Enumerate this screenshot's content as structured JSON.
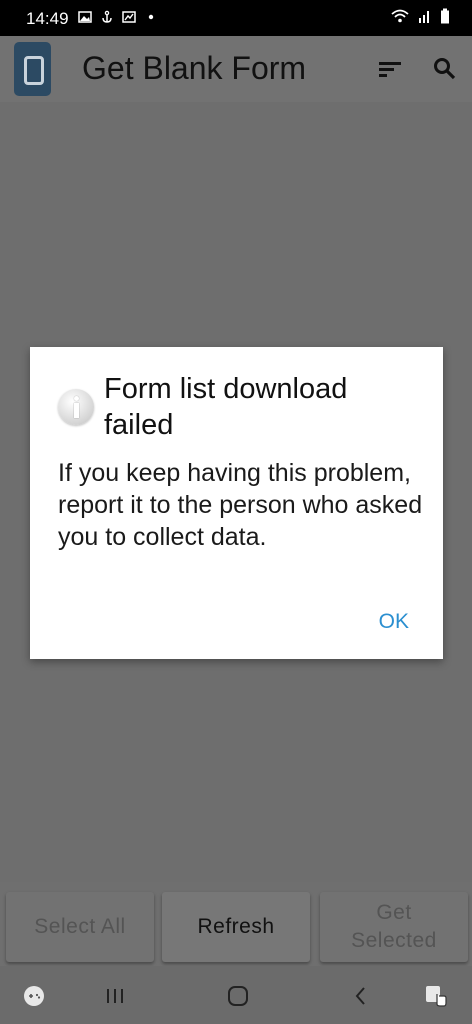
{
  "status_bar": {
    "time": "14:49"
  },
  "app_bar": {
    "title": "Get Blank Form"
  },
  "dialog": {
    "title": "Form list download failed",
    "message": "If you keep having this problem, report it to the person who asked you to collect data.",
    "ok_label": "OK"
  },
  "bottom_buttons": {
    "select_all": "Select All",
    "refresh": "Refresh",
    "get_selected": "Get Selected"
  },
  "icons": {
    "sort": "sort-icon",
    "search": "search-icon",
    "info": "info-icon"
  },
  "colors": {
    "accent": "#2b8fd0",
    "dim_background": "#6e6e6e",
    "logo_blue": "#2c4a63"
  }
}
